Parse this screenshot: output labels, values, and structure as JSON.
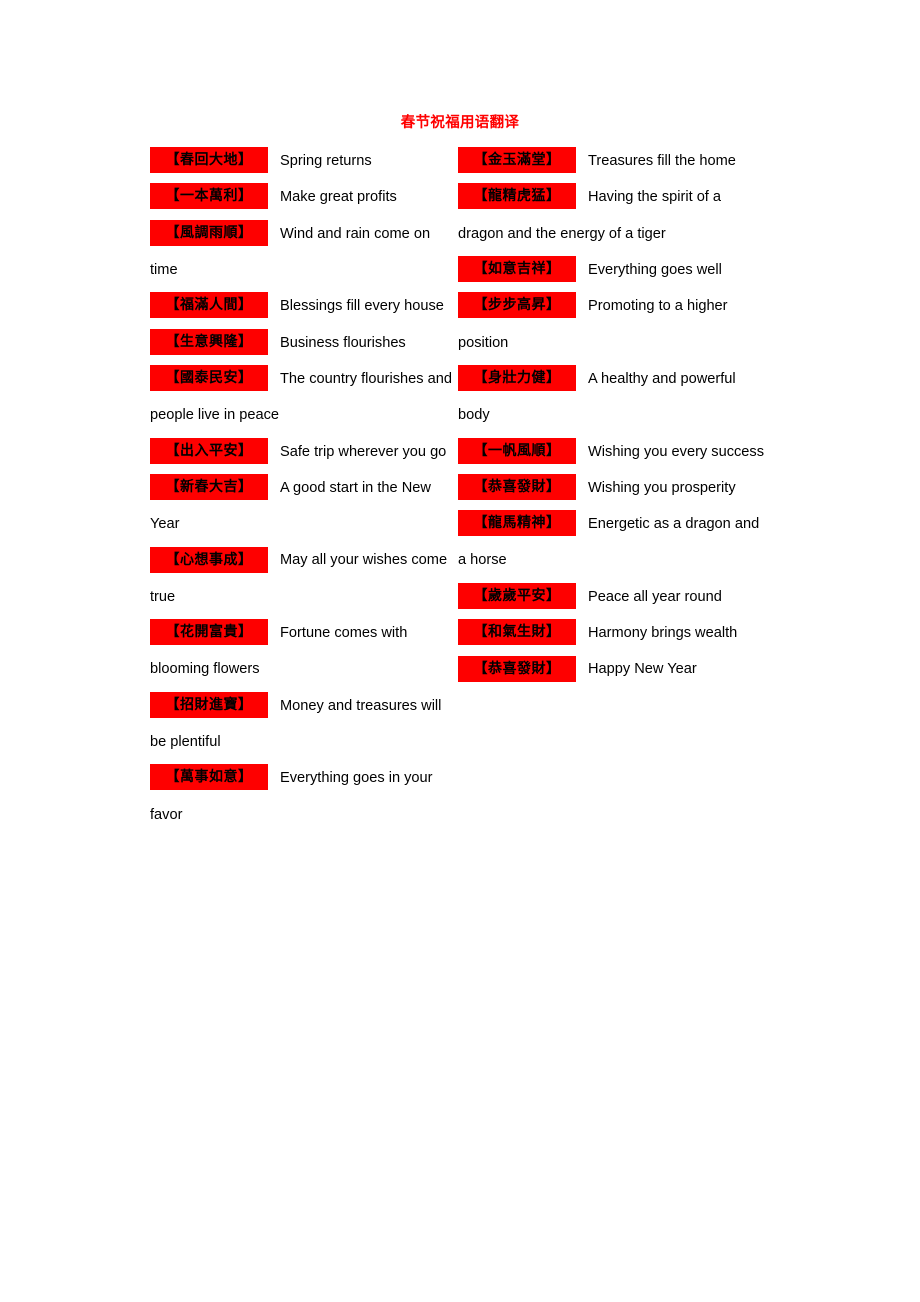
{
  "document": {
    "title": "春节祝福用语翻译",
    "title_color": "#ff0000",
    "banner_bg_color": "#fe0000",
    "banner_text_color": "#000000",
    "body_text_color": "#000000",
    "page_background": "#ffffff"
  },
  "columns": {
    "left": {
      "entries": [
        {
          "phrase": "【春回大地】",
          "translation": "Spring returns"
        },
        {
          "phrase": "【一本萬利】",
          "translation": "Make great profits"
        },
        {
          "phrase": "【風調雨順】",
          "translation": "Wind and rain come on time"
        },
        {
          "phrase": "【福滿人間】",
          "translation": "Blessings fill every house"
        },
        {
          "phrase": "【生意興隆】",
          "translation": "Business flourishes"
        },
        {
          "phrase": "【國泰民安】",
          "translation": "The country flourishes and people live in peace"
        },
        {
          "phrase": "【出入平安】",
          "translation": "Safe trip wherever you go"
        },
        {
          "phrase": "【新春大吉】",
          "translation": "A good start in the New Year"
        },
        {
          "phrase": "【心想事成】",
          "translation": "May all your wishes come true"
        },
        {
          "phrase": "【花開富貴】",
          "translation": "Fortune comes with blooming flowers"
        },
        {
          "phrase": "【招財進寶】",
          "translation": "Money and treasures will be plentiful"
        },
        {
          "phrase": "【萬事如意】",
          "translation": "Everything goes in your favor"
        }
      ]
    },
    "right": {
      "entries": [
        {
          "phrase": "【金玉滿堂】",
          "translation": "Treasures fill the home"
        },
        {
          "phrase": "【龍精虎猛】",
          "translation": "Having the spirit of a dragon and the energy of a tiger"
        },
        {
          "phrase": "【如意吉祥】",
          "translation": "Everything goes well"
        },
        {
          "phrase": "【步步高昇】",
          "translation": "Promoting to a higher position"
        },
        {
          "phrase": "【身壯力健】",
          "translation": "A healthy and powerful body"
        },
        {
          "phrase": "【一帆風順】",
          "translation": "Wishing you every success"
        },
        {
          "phrase": "【恭喜發財】",
          "translation": "Wishing you prosperity"
        },
        {
          "phrase": "【龍馬精神】",
          "translation": "Energetic as a dragon and a horse"
        },
        {
          "phrase": "【歲歲平安】",
          "translation": "Peace all year round"
        },
        {
          "phrase": "【和氣生財】",
          "translation": "Harmony brings wealth"
        },
        {
          "phrase": "【恭喜發財】",
          "translation": "Happy New Year"
        }
      ]
    }
  }
}
